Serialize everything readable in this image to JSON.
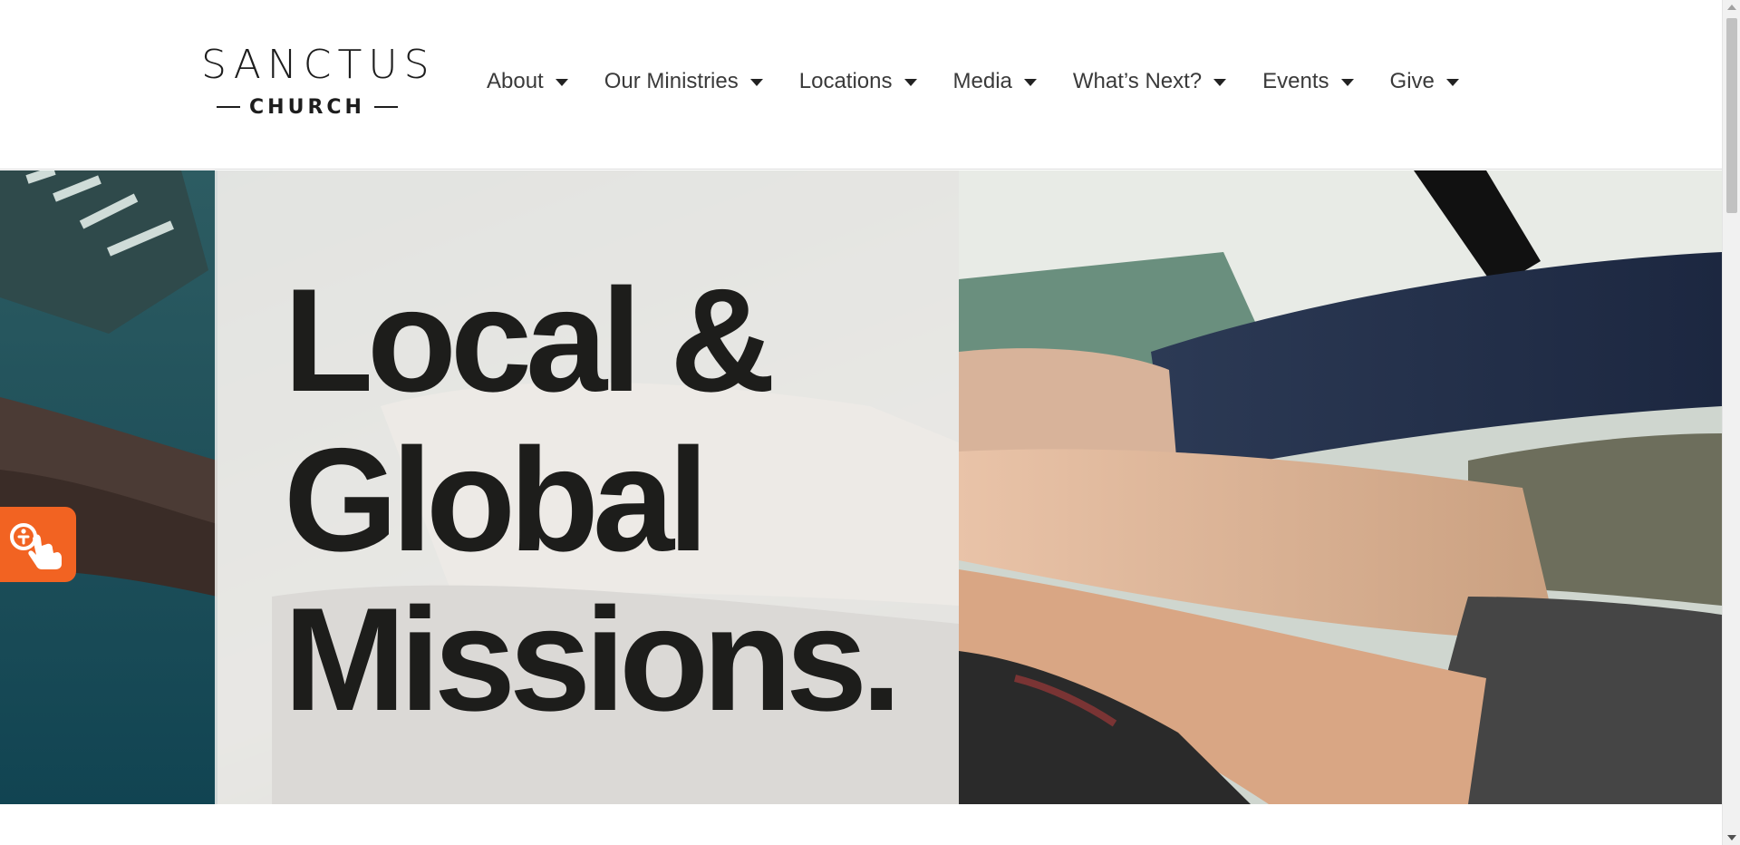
{
  "logo": {
    "name": "SANCTUS",
    "subtitle": "CHURCH"
  },
  "nav": {
    "items": [
      {
        "label": "About"
      },
      {
        "label": "Our Ministries"
      },
      {
        "label": "Locations"
      },
      {
        "label": "Media"
      },
      {
        "label": "What’s Next?"
      },
      {
        "label": "Events"
      },
      {
        "label": "Give"
      }
    ]
  },
  "hero": {
    "title_lines": [
      "Local &",
      "Global",
      "Missions."
    ]
  },
  "accessibility_button": {
    "icon": "accessibility-hand-icon",
    "color": "#f26322"
  },
  "colors": {
    "text_dark": "#1d1d1b",
    "nav_text": "#3a3a3a",
    "accent": "#f26322"
  }
}
